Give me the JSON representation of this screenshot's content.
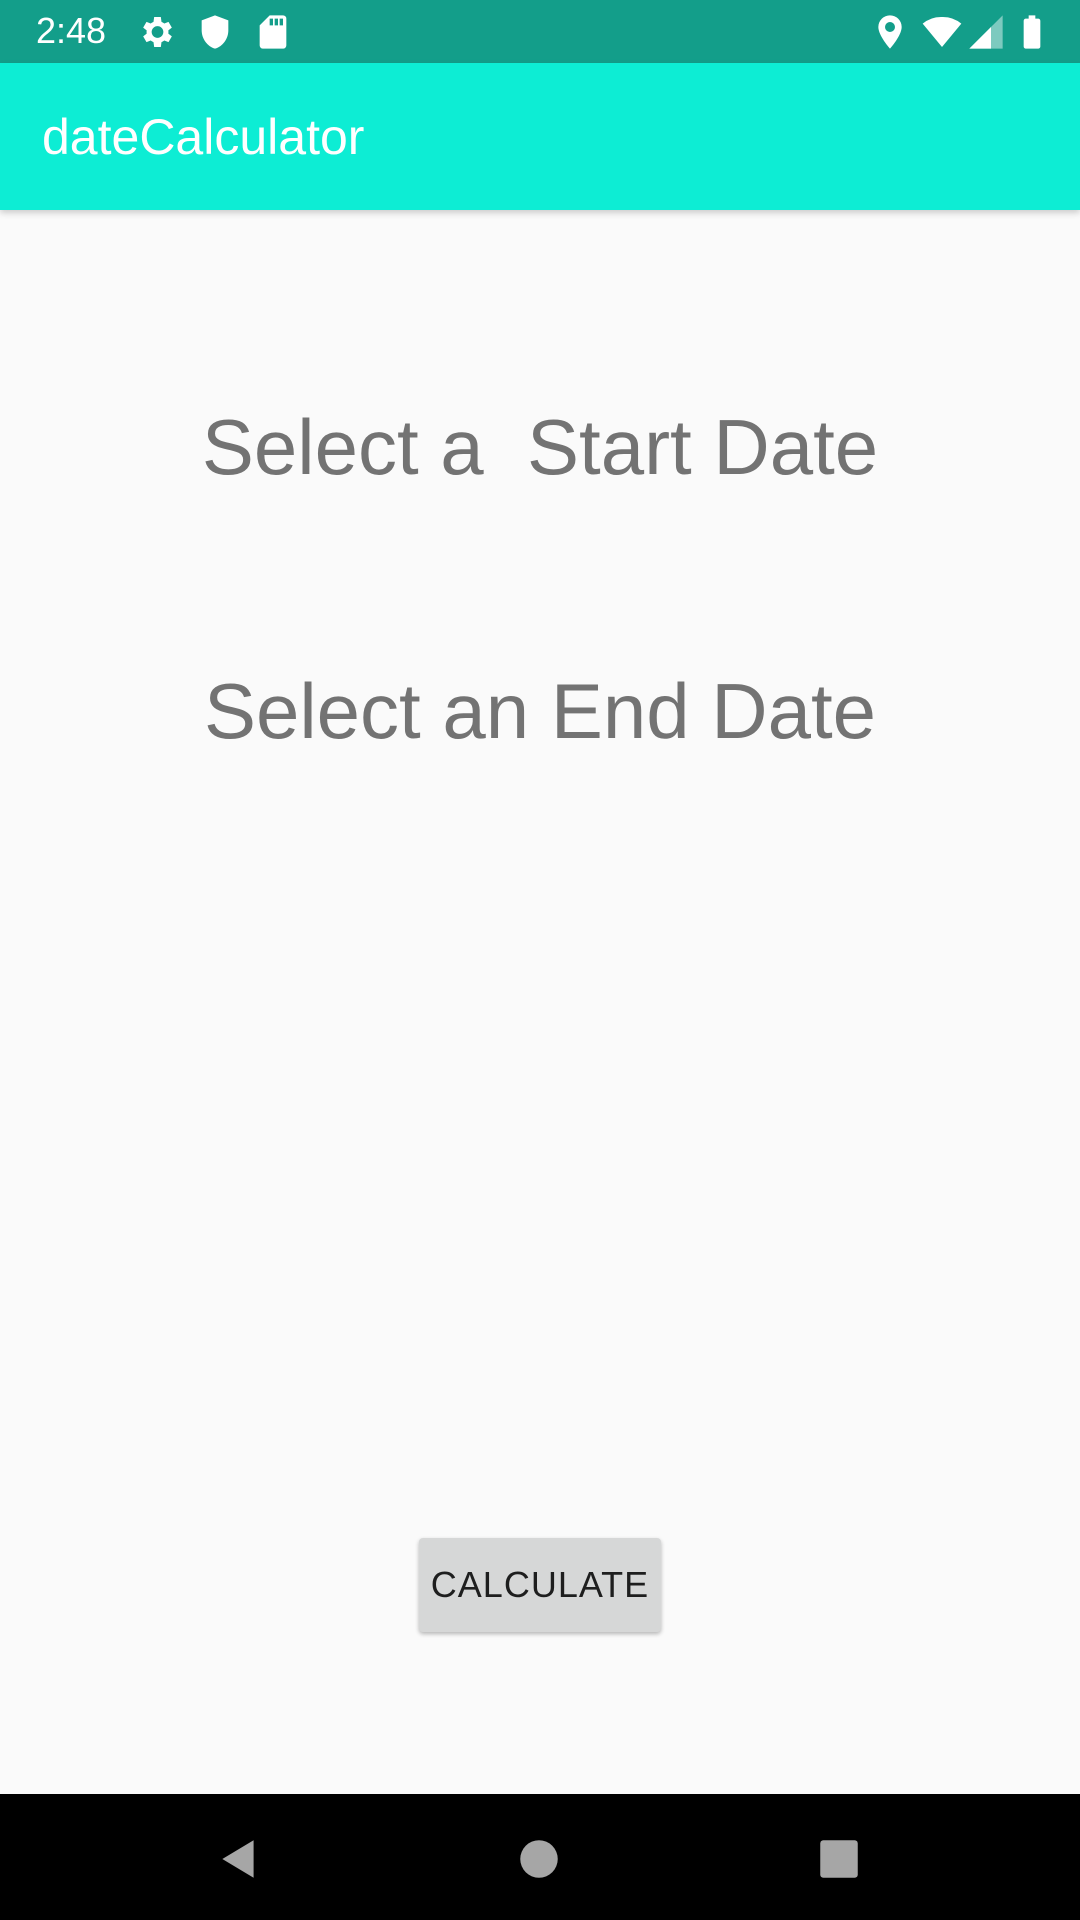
{
  "status_bar": {
    "time": "2:48",
    "icons": [
      "gear-icon",
      "shield-icon",
      "sd-card-icon",
      "location-icon",
      "wifi-icon",
      "signal-icon",
      "battery-icon"
    ],
    "background": "#139e8a"
  },
  "app_bar": {
    "title": "dateCalculator",
    "background": "#0dedd4"
  },
  "main": {
    "start_date_label": "Select a  Start Date",
    "end_date_label": "Select an End Date",
    "calculate_label": "CALCULATE"
  },
  "nav_bar": {
    "buttons": [
      "back-icon",
      "home-icon",
      "recents-icon"
    ]
  }
}
